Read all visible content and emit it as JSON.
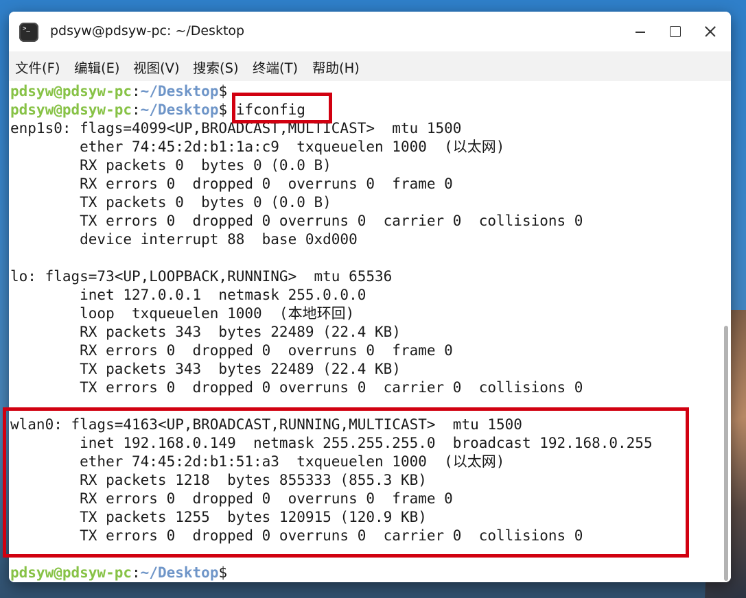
{
  "window": {
    "title": "pdsyw@pdsyw-pc: ~/Desktop",
    "app_icon": "terminal-icon",
    "controls": [
      "minimize-icon",
      "maximize-icon",
      "close-icon"
    ]
  },
  "menu": [
    "文件(F)",
    "编辑(E)",
    "视图(V)",
    "搜索(S)",
    "终端(T)",
    "帮助(H)"
  ],
  "prompt": {
    "user": "pdsyw@pdsyw-pc",
    "sep": ":",
    "path": "~/Desktop",
    "symbol": "$"
  },
  "command": " ifconfig",
  "output": [
    "enp1s0: flags=4099<UP,BROADCAST,MULTICAST>  mtu 1500",
    "        ether 74:45:2d:b1:1a:c9  txqueuelen 1000  (以太网)",
    "        RX packets 0  bytes 0 (0.0 B)",
    "        RX errors 0  dropped 0  overruns 0  frame 0",
    "        TX packets 0  bytes 0 (0.0 B)",
    "        TX errors 0  dropped 0 overruns 0  carrier 0  collisions 0",
    "        device interrupt 88  base 0xd000",
    "",
    "lo: flags=73<UP,LOOPBACK,RUNNING>  mtu 65536",
    "        inet 127.0.0.1  netmask 255.0.0.0",
    "        loop  txqueuelen 1000  (本地环回)",
    "        RX packets 343  bytes 22489 (22.4 KB)",
    "        RX errors 0  dropped 0  overruns 0  frame 0",
    "        TX packets 343  bytes 22489 (22.4 KB)",
    "        TX errors 0  dropped 0 overruns 0  carrier 0  collisions 0",
    "",
    "wlan0: flags=4163<UP,BROADCAST,RUNNING,MULTICAST>  mtu 1500",
    "        inet 192.168.0.149  netmask 255.255.255.0  broadcast 192.168.0.255",
    "        ether 74:45:2d:b1:51:a3  txqueuelen 1000  (以太网)",
    "        RX packets 1218  bytes 855333 (855.3 KB)",
    "        RX errors 0  dropped 0  overruns 0  frame 0",
    "        TX packets 1255  bytes 120915 (120.9 KB)",
    "        TX errors 0  dropped 0 overruns 0  carrier 0  collisions 0"
  ],
  "colors": {
    "prompt_user": "#87c246",
    "prompt_path": "#6e95c8",
    "highlight": "#d10010"
  }
}
